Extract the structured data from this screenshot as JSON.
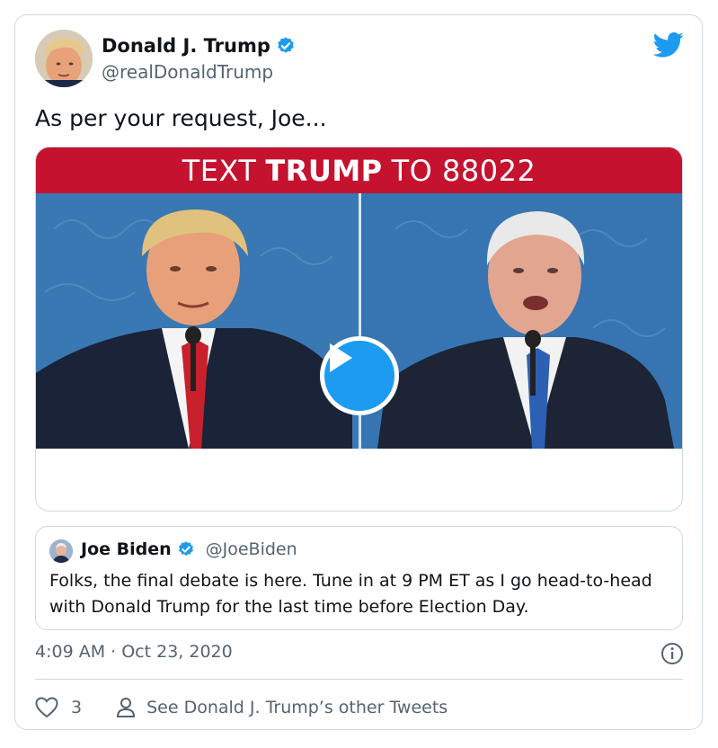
{
  "tweet": {
    "author_name": "Donald J. Trump",
    "author_handle": "@realDonaldTrump",
    "text": "As per your request, Joe...",
    "timestamp": "4:09 AM · Oct 23, 2020",
    "likes": "3",
    "other_tweets_label": "See Donald J. Trump’s other Tweets"
  },
  "media": {
    "banner_prefix": "TEXT",
    "banner_bold": "TRUMP",
    "banner_suffix": "TO 88022"
  },
  "quote": {
    "author_name": "Joe Biden",
    "author_handle": "@JoeBiden",
    "text": "Folks, the final debate is here. Tune in at 9 PM ET as I go head-to-head with Donald Trump for the last time before Election Day."
  },
  "colors": {
    "accent": "#1d9bf0",
    "banner": "#c4122f",
    "secondary_text": "#536471"
  },
  "icons": {
    "brand": "twitter-bird-icon",
    "verified": "verified-badge-icon",
    "play": "play-icon",
    "info": "info-icon",
    "like": "heart-icon",
    "profile": "person-icon"
  }
}
